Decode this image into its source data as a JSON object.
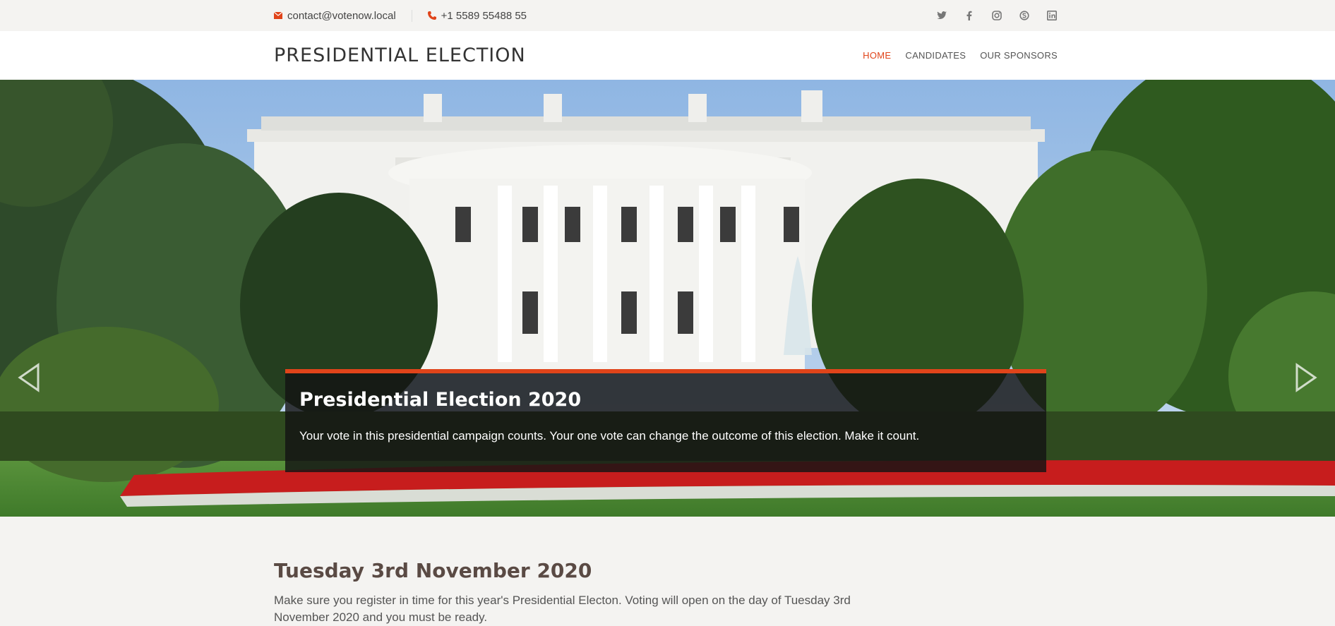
{
  "topbar": {
    "email": "contact@votenow.local",
    "phone": "+1 5589 55488 55",
    "socials": [
      "twitter-icon",
      "facebook-icon",
      "instagram-icon",
      "skype-icon",
      "linkedin-icon"
    ]
  },
  "header": {
    "logo": "PRESIDENTIAL ELECTION",
    "nav": [
      {
        "label": "HOME",
        "active": true
      },
      {
        "label": "CANDIDATES",
        "active": false
      },
      {
        "label": "OUR SPONSORS",
        "active": false
      }
    ]
  },
  "hero": {
    "title": "Presidential Election 2020",
    "text": "Your vote in this presidential campaign counts. Your one vote can change the outcome of this election. Make it count."
  },
  "content": {
    "heading": "Tuesday 3rd November 2020",
    "text": "Make sure you register in time for this year's Presidential Electon. Voting will open on the day of Tuesday 3rd November 2020 and you must be ready."
  },
  "colors": {
    "accent": "#e0441a",
    "topbar_bg": "#f4f3f1"
  }
}
